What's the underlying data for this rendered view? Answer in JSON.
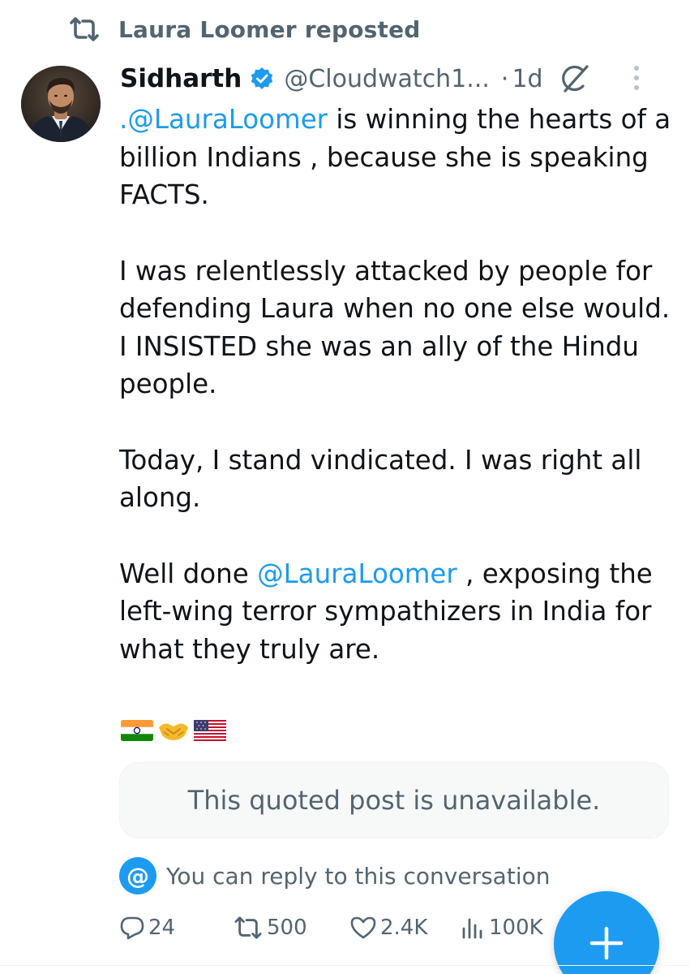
{
  "repost_banner": {
    "text": "Laura Loomer reposted",
    "icon": "repost-icon"
  },
  "author": {
    "display_name": "Sidharth",
    "verified": true,
    "handle": "@Cloudwatch1...",
    "separator": "·",
    "time": "1d",
    "avatar": "avatar-photo"
  },
  "tweet": {
    "paragraph1": {
      "mention": ".@LauraLoomer",
      "text": " is winning the hearts of a billion Indians , because she is speaking FACTS."
    },
    "paragraph2": "I was relentlessly attacked by people for defending Laura when no one else would. I INSISTED she was an ally of the Hindu people.",
    "paragraph3": "Today, I stand vindicated. I was right all along.",
    "paragraph4": {
      "prefix": "Well done ",
      "mention": "@LauraLoomer",
      "text": " , exposing the left-wing terror sympathizers in India for what they truly are."
    },
    "emojis": [
      "india-flag",
      "handshake",
      "us-flag"
    ]
  },
  "quoted_post": {
    "text": "This quoted post is unavailable."
  },
  "reply_restriction": {
    "badge": "@",
    "text": "You can reply to this conversation"
  },
  "actions": {
    "replies": "24",
    "reposts": "500",
    "likes": "2.4K",
    "views": "100K"
  },
  "colors": {
    "accent": "#1d9bf0",
    "secondary_text": "#536471",
    "primary_text": "#0f1419",
    "verified_badge": "#1d9bf0"
  }
}
